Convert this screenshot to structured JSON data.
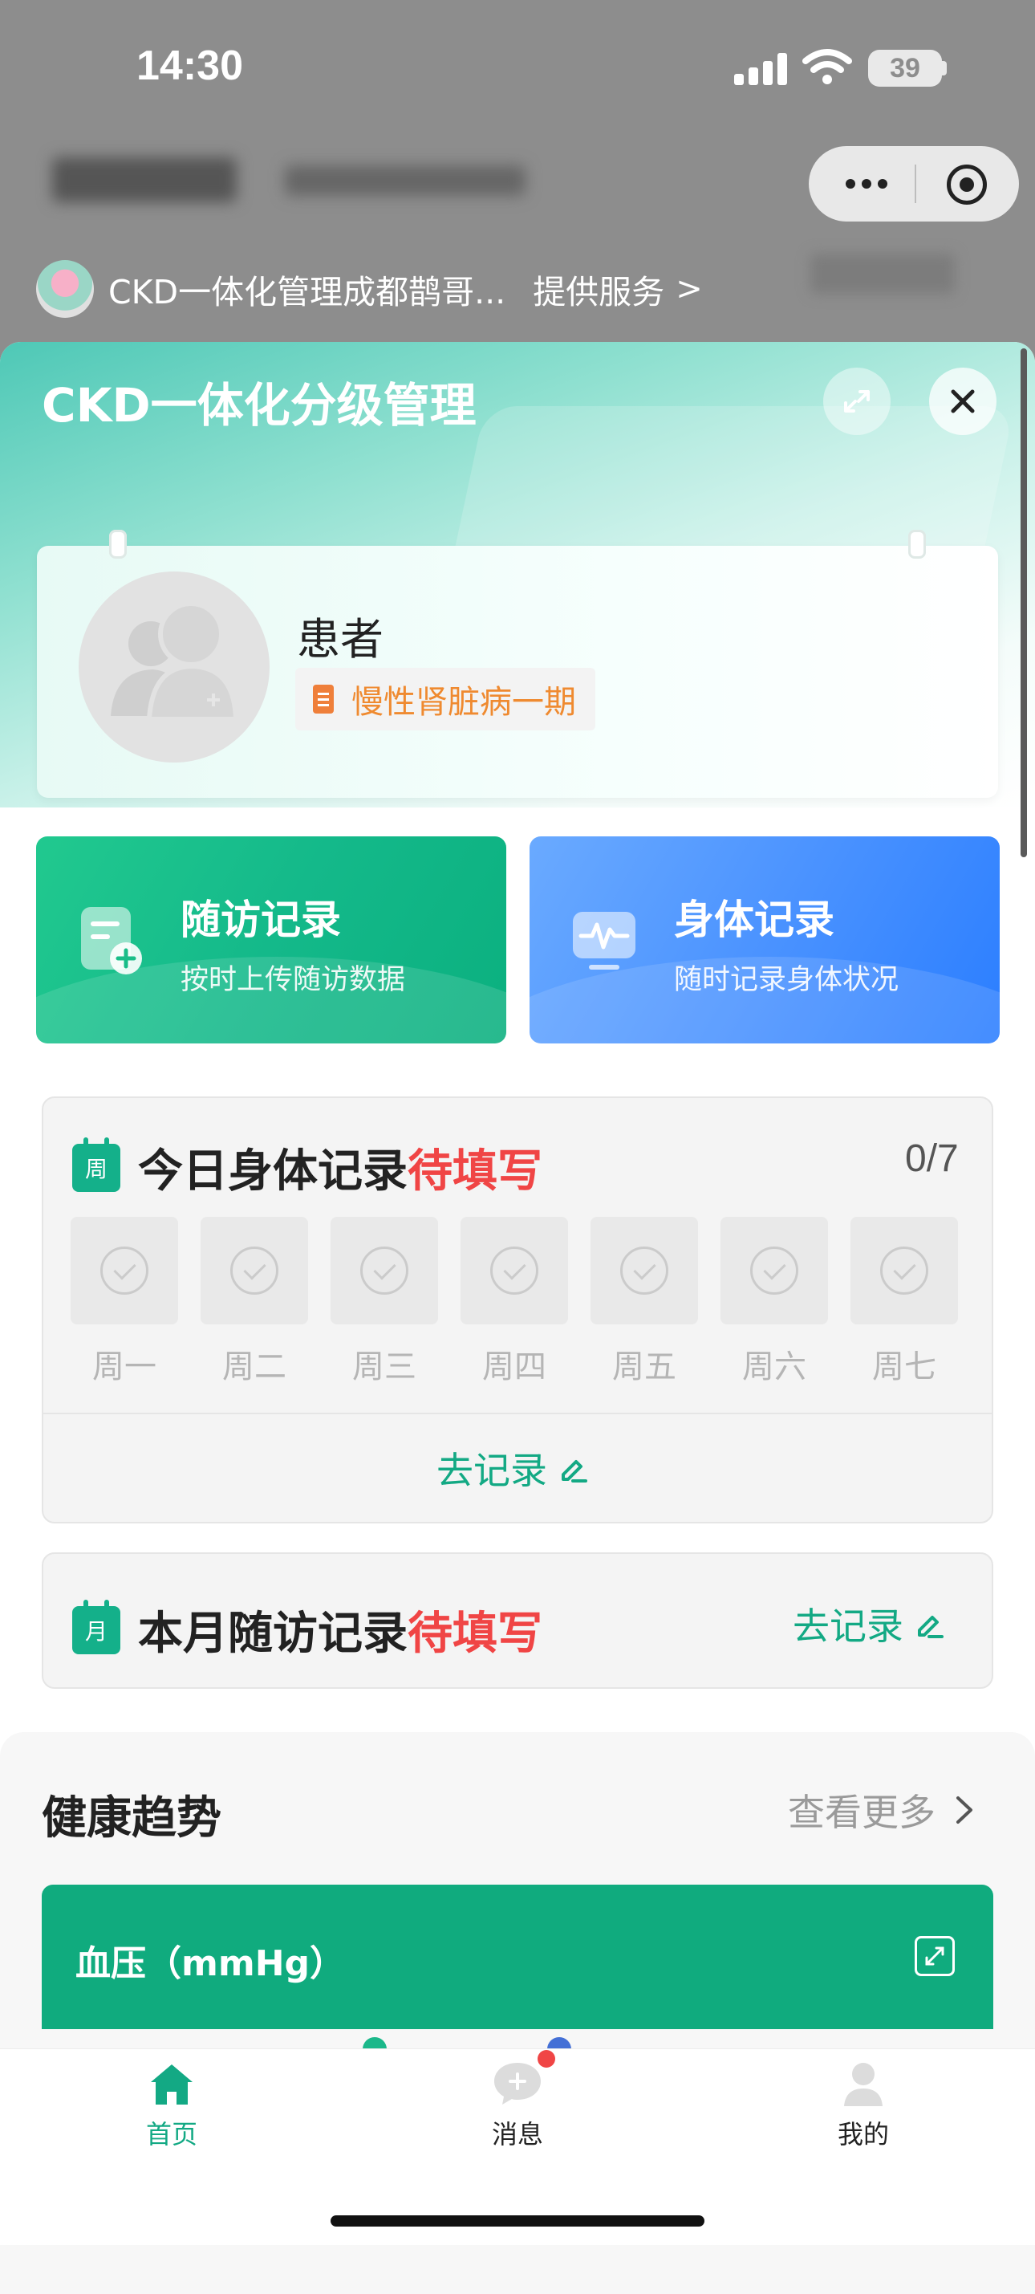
{
  "status_bar": {
    "time": "14:30",
    "battery": "39"
  },
  "service": {
    "name": "CKD一体化管理成都鹊哥...",
    "provide_label": "提供服务",
    "chevron": ">"
  },
  "sheet": {
    "title": "CKD一体化分级管理"
  },
  "profile": {
    "name": "患者",
    "disease_tag": "慢性肾脏病一期"
  },
  "actions": [
    {
      "title": "随访记录",
      "subtitle": "按时上传随访数据",
      "icon": "followup-doc-icon"
    },
    {
      "title": "身体记录",
      "subtitle": "随时记录身体状况",
      "icon": "monitor-icon"
    }
  ],
  "daily": {
    "icon_text": "周",
    "title": "今日身体记录",
    "status": "待填写",
    "count": "0/7",
    "days": [
      "周一",
      "周二",
      "周三",
      "周四",
      "周五",
      "周六",
      "周七"
    ],
    "go_label": "去记录"
  },
  "monthly": {
    "icon_text": "月",
    "title": "本月随访记录",
    "status": "待填写",
    "go_label": "去记录"
  },
  "trend": {
    "title": "健康趋势",
    "more": "查看更多",
    "bp_title": "血压（mmHg）"
  },
  "tabbar": {
    "items": [
      {
        "label": "首页",
        "icon": "home-icon",
        "active": true
      },
      {
        "label": "消息",
        "icon": "message-icon",
        "active": false
      },
      {
        "label": "我的",
        "icon": "profile-icon",
        "active": false
      }
    ]
  },
  "colors": {
    "accent_green": "#13a984",
    "pending_red": "#f04545",
    "tag_orange": "#ef8a30",
    "blue_card": "#4b93ff"
  }
}
